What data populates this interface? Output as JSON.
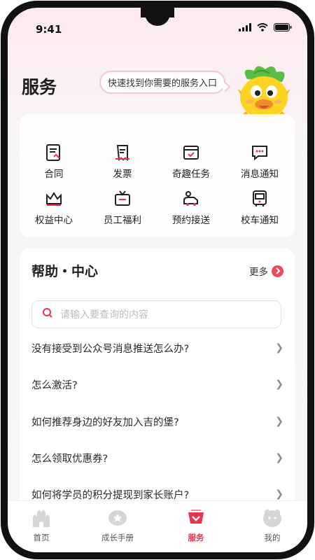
{
  "status": {
    "time": "9:41"
  },
  "header": {
    "title": "服务",
    "bubble_text": "快速找到你需要的服务入口"
  },
  "services": [
    {
      "label": "合同",
      "icon": "contract-icon"
    },
    {
      "label": "发票",
      "icon": "invoice-icon"
    },
    {
      "label": "奇趣任务",
      "icon": "task-icon"
    },
    {
      "label": "消息通知",
      "icon": "message-icon"
    },
    {
      "label": "权益中心",
      "icon": "crown-icon"
    },
    {
      "label": "员工福利",
      "icon": "tv-gift-icon"
    },
    {
      "label": "预约接送",
      "icon": "pickup-icon"
    },
    {
      "label": "校车通知",
      "icon": "bus-icon"
    }
  ],
  "help": {
    "title": "帮助・中心",
    "more_label": "更多",
    "search_placeholder": "请输入要查询的内容",
    "questions": [
      "没有接受到公众号消息推送怎么办?",
      "怎么激活?",
      "如何推荐身边的好友加入吉的堡?",
      "怎么领取优惠券?",
      "如何将学员的积分提现到家长账户?"
    ]
  },
  "tabbar": {
    "items": [
      {
        "label": "首页",
        "icon": "castle-icon",
        "active": false
      },
      {
        "label": "成长手册",
        "icon": "handbook-icon",
        "active": false
      },
      {
        "label": "服务",
        "icon": "service-icon",
        "active": true
      },
      {
        "label": "我的",
        "icon": "profile-icon",
        "active": false
      }
    ]
  },
  "colors": {
    "accent": "#e8344e",
    "bubble_border": "#f3c7d0",
    "text": "#222222"
  }
}
